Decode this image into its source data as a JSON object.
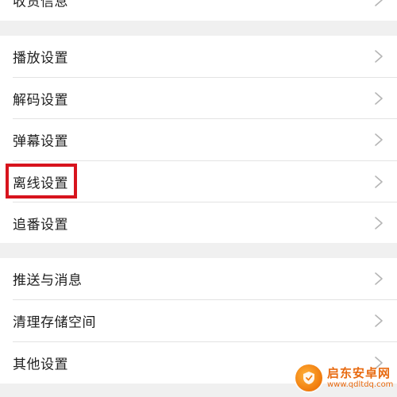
{
  "top_partial": {
    "label": "收货信息"
  },
  "group1": {
    "items": [
      {
        "label": "播放设置"
      },
      {
        "label": "解码设置"
      },
      {
        "label": "弹幕设置"
      },
      {
        "label": "离线设置"
      },
      {
        "label": "追番设置"
      }
    ]
  },
  "group2": {
    "items": [
      {
        "label": "推送与消息"
      },
      {
        "label": "清理存储空间"
      },
      {
        "label": "其他设置"
      }
    ]
  },
  "watermark": {
    "title": "启东安卓网",
    "url": "www.qdltdq.com"
  },
  "colors": {
    "highlight": "#d7141d",
    "page_bg": "#f0f0f0",
    "row_bg": "#ffffff",
    "chevron": "#b5b5b5"
  },
  "icons": {
    "chevron": "chevron-right-icon"
  }
}
